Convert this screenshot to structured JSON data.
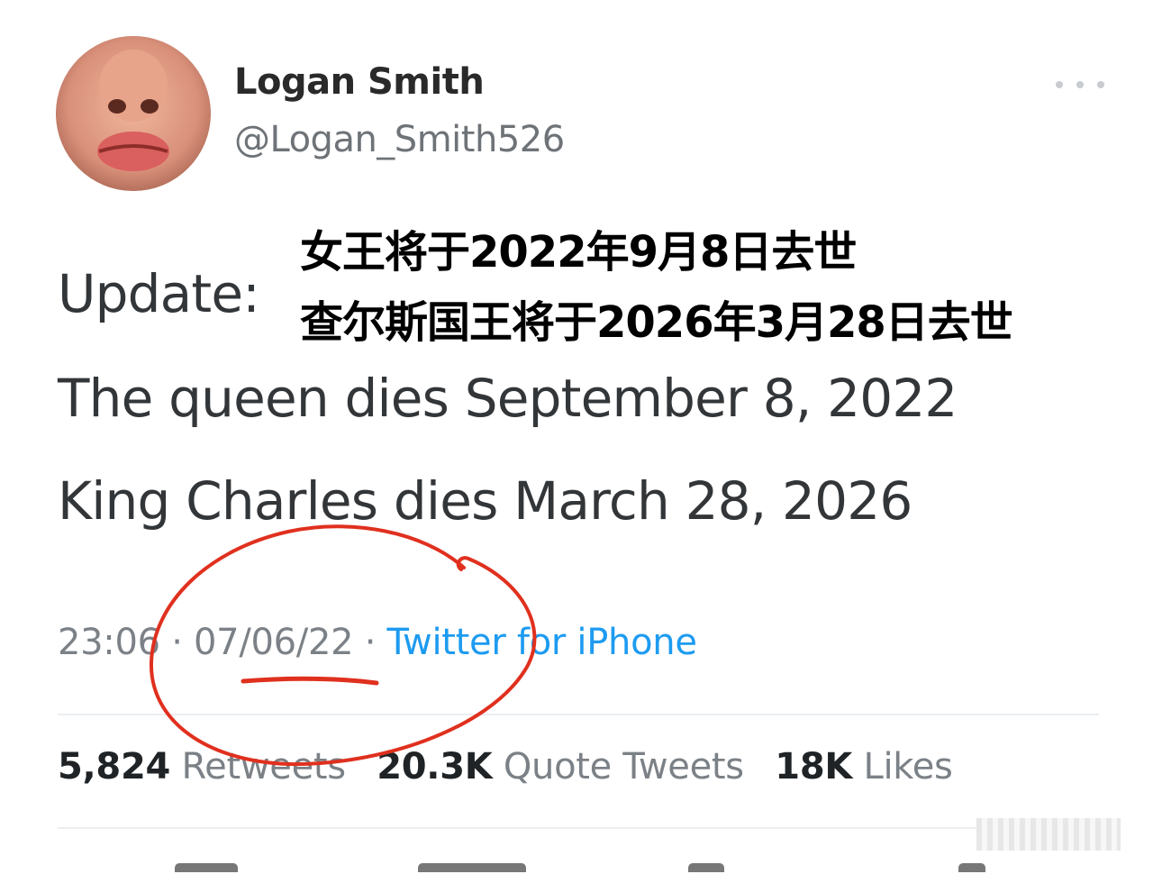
{
  "tweet": {
    "author": {
      "display_name": "Logan Smith",
      "handle": "@Logan_Smith526"
    },
    "lines": {
      "update": "Update:",
      "queen": "The queen dies September 8, 2022",
      "king": "King Charles dies March 28, 2026"
    },
    "meta": {
      "time": "23:06",
      "separator": " · ",
      "date": "07/06/22",
      "source": "Twitter for iPhone"
    },
    "stats": [
      {
        "count": "5,824",
        "label": "Retweets"
      },
      {
        "count": "20.3K",
        "label": "Quote Tweets"
      },
      {
        "count": "18K",
        "label": "Likes"
      }
    ]
  },
  "overlay_caption": {
    "line1": "女王将于2022年9月8日去世",
    "line2": "查尔斯国王将于2026年3月28日去世"
  },
  "icons": {
    "more": "more-horizontal-icon",
    "avatar": "avatar-face-image"
  },
  "colors": {
    "link_blue": "#1d9bf0",
    "annotation_red": "#e0301e",
    "muted_text": "#7b8186"
  }
}
